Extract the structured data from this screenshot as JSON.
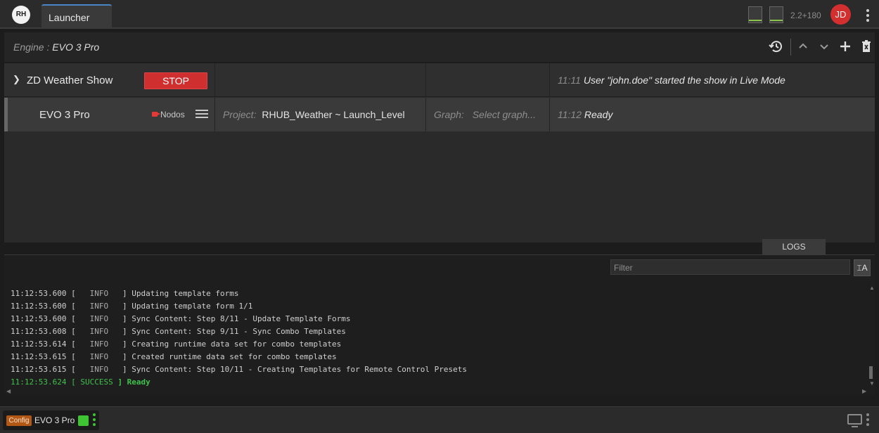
{
  "topbar": {
    "logo_text": "RH",
    "tab_label": "Launcher",
    "version": "2.2+180",
    "user_initials": "JD"
  },
  "engine_header": {
    "label": "Engine :",
    "engine": "EVO 3 Pro"
  },
  "show": {
    "name": "ZD Weather Show",
    "stop_label": "STOP",
    "status_time": "11:11",
    "status_message": "User \"john.doe\" started the show in Live Mode"
  },
  "engine_row": {
    "name": "EVO 3 Pro",
    "nodos_label": "Nodos",
    "project_label": "Project:",
    "project_value": "RHUB_Weather ~ Launch_Level",
    "graph_label": "Graph:",
    "graph_placeholder": "Select graph...",
    "status_time": "11:12",
    "status_message": "Ready"
  },
  "logs": {
    "tab_label": "LOGS",
    "filter_placeholder": "Filter",
    "wrap_button": "⌶A",
    "lines": [
      {
        "time": "11:12:53.600",
        "level": "INFO",
        "message": "Updating template forms"
      },
      {
        "time": "11:12:53.600",
        "level": "INFO",
        "message": "Updating template form 1/1"
      },
      {
        "time": "11:12:53.600",
        "level": "INFO",
        "message": "Sync Content: Step 8/11 - Update Template Forms"
      },
      {
        "time": "11:12:53.608",
        "level": "INFO",
        "message": "Sync Content: Step 9/11 - Sync Combo Templates"
      },
      {
        "time": "11:12:53.614",
        "level": "INFO",
        "message": "Creating runtime data set for combo templates"
      },
      {
        "time": "11:12:53.615",
        "level": "INFO",
        "message": "Created runtime data set for combo templates"
      },
      {
        "time": "11:12:53.615",
        "level": "INFO",
        "message": "Sync Content: Step 10/11 - Creating Templates for Remote Control Presets"
      },
      {
        "time": "11:12:53.624",
        "level": "SUCCESS",
        "message": "Ready"
      }
    ]
  },
  "statusbar": {
    "config_label": "Config",
    "engine_name": "EVO 3 Pro",
    "engine_status_color": "#3ec332"
  },
  "icons": {
    "history": "history-icon",
    "up": "chevron-up-icon",
    "down": "chevron-down-icon",
    "add": "plus-icon",
    "delete": "trash-icon",
    "monitor": "monitor-icon"
  }
}
